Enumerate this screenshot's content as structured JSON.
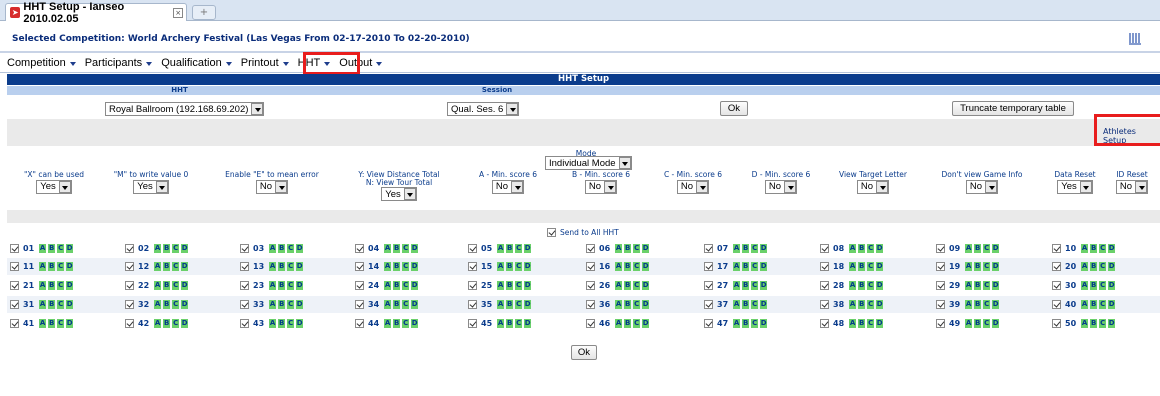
{
  "browser_tab": {
    "title": "HHT Setup - Ianseo 2010.02.05",
    "icon": "archery-target-icon"
  },
  "header": {
    "competition_title": "Selected Competition: World Archery Festival (Las Vegas From 02-17-2010 To 02-20-2010)",
    "logo_icon": "ianseo-logo-icon"
  },
  "menu": {
    "items": [
      {
        "label": "Competition"
      },
      {
        "label": "Participants"
      },
      {
        "label": "Qualification"
      },
      {
        "label": "Printout"
      },
      {
        "label": "HHT"
      },
      {
        "label": "Output"
      }
    ]
  },
  "setup": {
    "title": "HHT Setup",
    "col_hht": "HHT",
    "col_session": "Session",
    "hht_selected": "Royal Ballroom (192.168.69.202)",
    "session_selected": "Qual. Ses. 6",
    "ok_label": "Ok",
    "truncate_label": "Truncate temporary table",
    "athletes_setup_link": "Athletes Setup",
    "mode_label": "Mode",
    "mode_selected": "Individual Mode"
  },
  "options": [
    {
      "label1": "\"X\" can be used",
      "label2": "",
      "value": "Yes"
    },
    {
      "label1": "\"M\" to write value 0",
      "label2": "",
      "value": "Yes"
    },
    {
      "label1": "Enable \"E\" to mean error",
      "label2": "",
      "value": "No"
    },
    {
      "label1": "Y: View Distance Total",
      "label2": "N: View Tour Total",
      "value": "Yes"
    },
    {
      "label1": "A - Min. score 6",
      "label2": "",
      "value": "No"
    },
    {
      "label1": "B - Min. score 6",
      "label2": "",
      "value": "No"
    },
    {
      "label1": "C - Min. score 6",
      "label2": "",
      "value": "No"
    },
    {
      "label1": "D - Min. score 6",
      "label2": "",
      "value": "No"
    },
    {
      "label1": "View Target Letter",
      "label2": "",
      "value": "No"
    },
    {
      "label1": "Don't view Game Info",
      "label2": "",
      "value": "No"
    },
    {
      "label1": "Data Reset",
      "label2": "",
      "value": "Yes"
    },
    {
      "label1": "ID Reset",
      "label2": "",
      "value": "No"
    }
  ],
  "send_all_label": "Send to All HHT",
  "device_letters": [
    "A",
    "B",
    "C",
    "D"
  ],
  "devices": [
    "01",
    "02",
    "03",
    "04",
    "05",
    "06",
    "07",
    "08",
    "09",
    "10",
    "11",
    "12",
    "13",
    "14",
    "15",
    "16",
    "17",
    "18",
    "19",
    "20",
    "21",
    "22",
    "23",
    "24",
    "25",
    "26",
    "27",
    "28",
    "29",
    "30",
    "31",
    "32",
    "33",
    "34",
    "35",
    "36",
    "37",
    "38",
    "39",
    "40",
    "41",
    "42",
    "43",
    "44",
    "45",
    "46",
    "47",
    "48",
    "49",
    "50"
  ],
  "bottom_ok_label": "Ok"
}
